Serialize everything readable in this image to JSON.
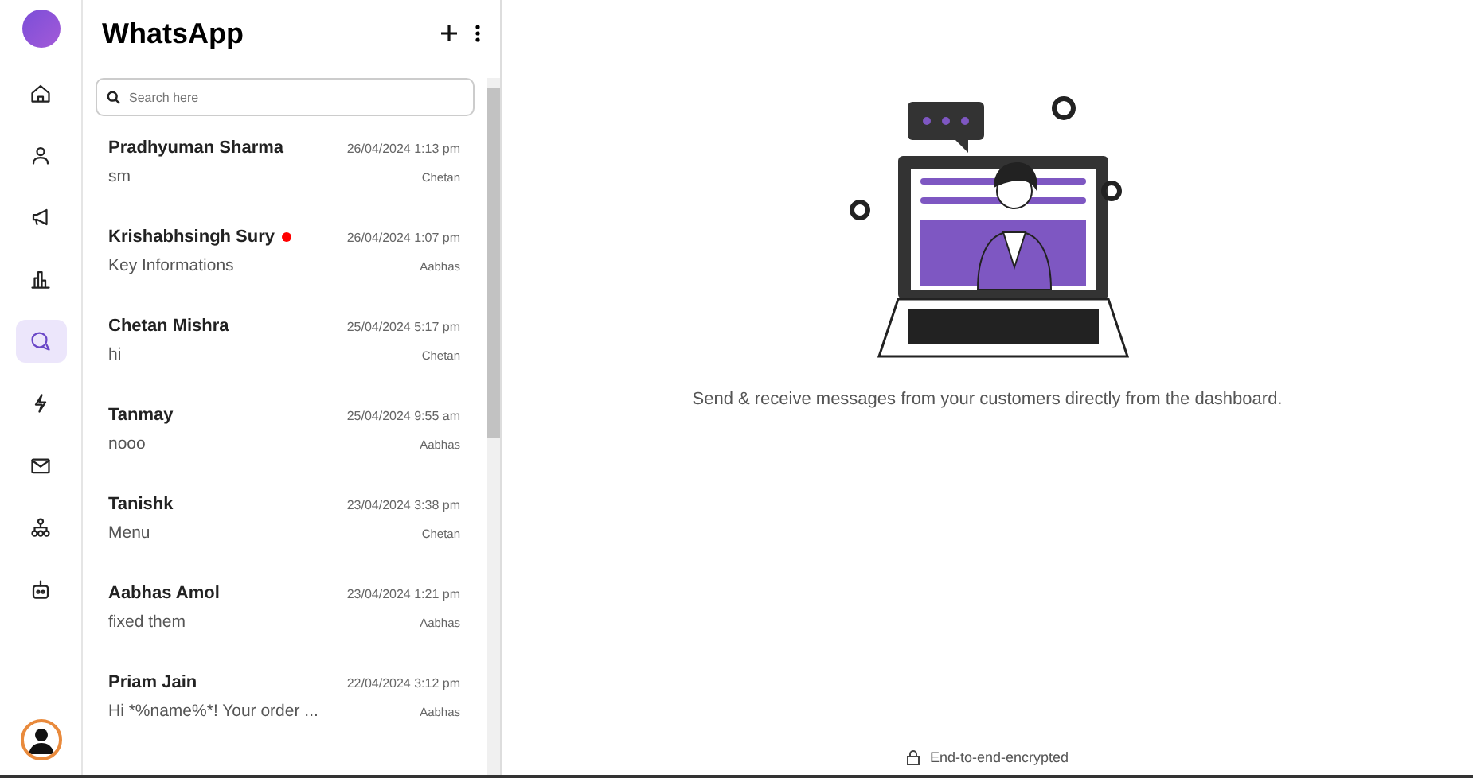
{
  "nav": [
    {
      "kind": "home",
      "selected": false
    },
    {
      "kind": "user",
      "selected": false
    },
    {
      "kind": "megaphone",
      "selected": false
    },
    {
      "kind": "chart",
      "selected": false
    },
    {
      "kind": "chat",
      "selected": true
    },
    {
      "kind": "bolt",
      "selected": false
    },
    {
      "kind": "mail",
      "selected": false
    },
    {
      "kind": "org",
      "selected": false
    },
    {
      "kind": "bot",
      "selected": false
    }
  ],
  "panel": {
    "title": "WhatsApp",
    "search": {
      "placeholder": "Search here"
    }
  },
  "chats": [
    {
      "name": "Pradhyuman Sharma",
      "unread": false,
      "time": "26/04/2024 1:13 pm",
      "preview": "sm",
      "agent": "Chetan"
    },
    {
      "name": "Krishabhsingh Sury",
      "unread": true,
      "time": "26/04/2024 1:07 pm",
      "preview": "Key Informations",
      "agent": "Aabhas"
    },
    {
      "name": "Chetan Mishra",
      "unread": false,
      "time": "25/04/2024 5:17 pm",
      "preview": "hi",
      "agent": "Chetan"
    },
    {
      "name": "Tanmay",
      "unread": false,
      "time": "25/04/2024 9:55 am",
      "preview": "nooo",
      "agent": "Aabhas"
    },
    {
      "name": "Tanishk",
      "unread": false,
      "time": "23/04/2024 3:38 pm",
      "preview": "Menu",
      "agent": "Chetan"
    },
    {
      "name": "Aabhas Amol",
      "unread": false,
      "time": "23/04/2024 1:21 pm",
      "preview": "fixed them",
      "agent": "Aabhas"
    },
    {
      "name": "Priam Jain",
      "unread": false,
      "time": "22/04/2024 3:12 pm",
      "preview": "Hi *%name%*! Your order ...",
      "agent": "Aabhas"
    }
  ],
  "main": {
    "caption": "Send & receive messages from your customers directly from the dashboard.",
    "footer": "End-to-end-encrypted"
  }
}
